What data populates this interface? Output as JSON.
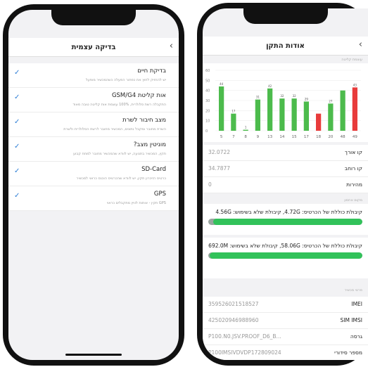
{
  "left": {
    "title": "בדיקה עצמית",
    "items": [
      {
        "title": "בדיקת חיים",
        "subtitle": "יש להחזיק לחוץ את כפתור הפעלה כשהמכשיר מופעל"
      },
      {
        "title": "אות קליטת GSM/G4",
        "subtitle": "התקבלה רשת סלולרית, 100% עוצמת אות קליטה טובה מאוד"
      },
      {
        "title": "מצב חיבור לשרת",
        "subtitle": "השרת מחובר ומקבל נתונים, המכשיר מחובר לרשת הסלולרית ולשרת"
      },
      {
        "title": "מוניטין מצב?",
        "subtitle": "תקין, המכשיר בתנועה, יש לוודא שהמכשיר מחובר למתח קבוע"
      },
      {
        "title": "SD-Card",
        "subtitle": "כרטיס הזיכרון תקין, יש לוודא שהכרטיס הוכנס כראוי למכשיר"
      },
      {
        "title": "GPS",
        "subtitle": "GPS תקין - אותות לוויין מתקבלים כראוי"
      }
    ]
  },
  "right": {
    "title": "אודות התקן",
    "chart_section": "עוצמת קליטה",
    "chart_data": {
      "type": "bar",
      "categories": [
        "5",
        "7",
        "8",
        "9",
        "13",
        "14",
        "15",
        "17",
        "18",
        "20",
        "48",
        "49"
      ],
      "values": [
        44,
        17,
        1,
        31,
        42,
        32,
        32,
        29,
        17,
        27,
        40,
        43
      ],
      "labels": [
        "44",
        "17",
        "1",
        "31",
        "42",
        "32",
        "32",
        "29",
        "",
        "27",
        "",
        "43"
      ],
      "colors": [
        "#4cbb4c",
        "#4cbb4c",
        "#4cbb4c",
        "#4cbb4c",
        "#4cbb4c",
        "#4cbb4c",
        "#4cbb4c",
        "#4cbb4c",
        "#e83b3b",
        "#4cbb4c",
        "#4cbb4c",
        "#e83b3b"
      ],
      "yticks": [
        "60",
        "50",
        "40",
        "30",
        "20",
        "10",
        "0"
      ],
      "ylim": [
        0,
        60
      ]
    },
    "kv1": [
      {
        "k": "קו אורך",
        "v": "32.0722"
      },
      {
        "k": "קו רוחב",
        "v": "34.7877"
      },
      {
        "k": "מהירות",
        "v": "0"
      }
    ],
    "storage_section": "מקום אחסון",
    "storage1": {
      "text": "קיבולת כוללת של הכרטיס: 4.72G, קיבולת שלא בשימוש: 4.56G",
      "used_fraction": 0.97
    },
    "storage2": {
      "text": "קיבולת כוללת של הכרטיס: 58.06G, קיבולת שלא בשימוש: 692.0M",
      "used_fraction": 0.99
    },
    "info_section": "פרטי מכשיר",
    "kv2": [
      {
        "k": "IMEI",
        "v": "359526021518527"
      },
      {
        "k": "SIM IMSI",
        "v": "425020946988960"
      },
      {
        "k": "גרסה",
        "v": "P100.N0.JSV.PROOF_D6_B..."
      },
      {
        "k": "מספר סידורי",
        "v": "P100IMSIVDVDP172809024"
      }
    ]
  }
}
